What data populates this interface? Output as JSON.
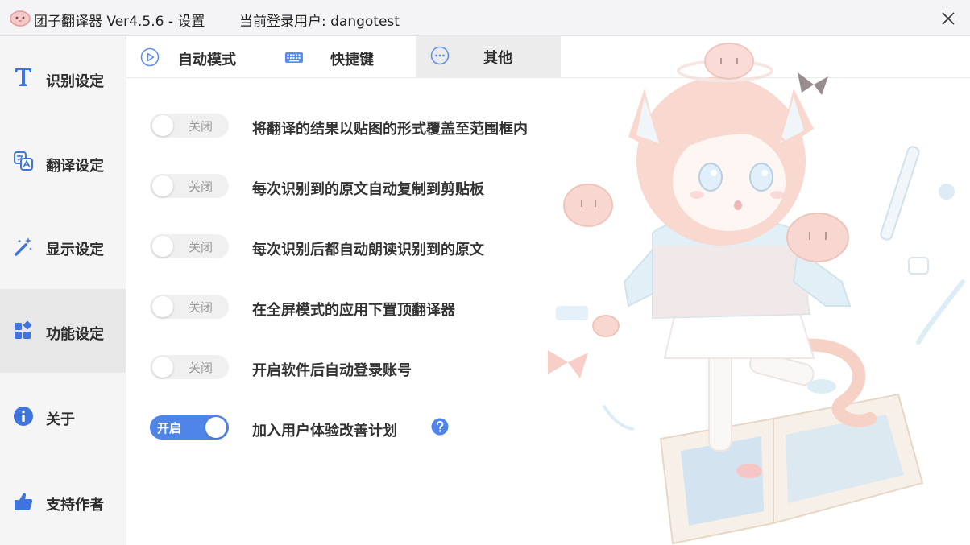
{
  "window": {
    "title": "团子翻译器 Ver4.5.6 - 设置",
    "user_text": "当前登录用户: dangotest"
  },
  "sidebar": {
    "items": [
      {
        "label": "识别设定",
        "icon": "text-t-icon"
      },
      {
        "label": "翻译设定",
        "icon": "translate-icon"
      },
      {
        "label": "显示设定",
        "icon": "magic-wand-icon"
      },
      {
        "label": "功能设定",
        "icon": "apps-grid-icon",
        "active": true
      },
      {
        "label": "关于",
        "icon": "info-icon"
      },
      {
        "label": "支持作者",
        "icon": "thumbs-up-icon"
      }
    ]
  },
  "tabs": [
    {
      "label": "自动模式",
      "icon": "play-circle-icon"
    },
    {
      "label": "快捷键",
      "icon": "keyboard-icon"
    },
    {
      "label": "其他",
      "icon": "more-dots-icon",
      "active": true
    }
  ],
  "options": [
    {
      "label": "将翻译的结果以贴图的形式覆盖至范围框内",
      "state": "关闭",
      "enabled": false
    },
    {
      "label": "每次识别到的原文自动复制到剪贴板",
      "state": "关闭",
      "enabled": false
    },
    {
      "label": "每次识别后都自动朗读识别到的原文",
      "state": "关闭",
      "enabled": false
    },
    {
      "label": "在全屏模式的应用下置顶翻译器",
      "state": "关闭",
      "enabled": false
    },
    {
      "label": "开启软件后自动登录账号",
      "state": "关闭",
      "enabled": false
    },
    {
      "label": "加入用户体验改善计划",
      "state": "开启",
      "enabled": true
    }
  ],
  "colors": {
    "accent": "#4f84e8",
    "sidebar_bg": "#f5f5f5",
    "sidebar_active": "#e7e7e7",
    "toggle_off": "#f0f0f0"
  }
}
